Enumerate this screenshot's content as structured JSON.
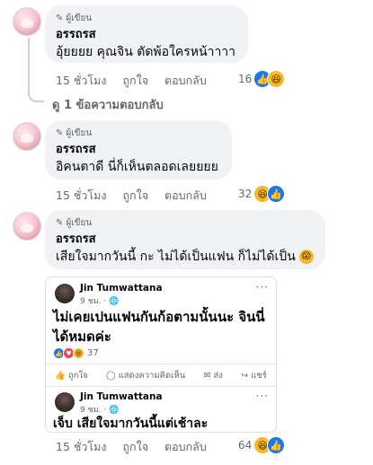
{
  "comments": [
    {
      "badge": "ผู้เขียน",
      "author": "อรรถรส",
      "text": "อุ้ยยยย คุณจิน ตัดพ้อใครหน้าาาา",
      "time": "15 ชั่วโมง",
      "like_label": "ถูกใจ",
      "reply_label": "ตอบกลับ",
      "reaction_count": "16",
      "reactions": [
        "like-icon",
        "haha-icon"
      ]
    },
    {
      "badge": "ผู้เขียน",
      "author": "อรรถรส",
      "text": "อิคนตาดี นี่ก็เห็นตลอดเลยยยย",
      "time": "15 ชั่วโมง",
      "like_label": "ถูกใจ",
      "reply_label": "ตอบกลับ",
      "reaction_count": "32",
      "reactions": [
        "haha-icon",
        "like-icon"
      ]
    },
    {
      "badge": "ผู้เขียน",
      "author": "อรรถรส",
      "text": "เสียใจมากวันนี้ กะ ไม่ได้เป็นแฟน ก็ไม่ได้เป็น",
      "time": "15 ชั่วโมง",
      "like_label": "ถูกใจ",
      "reply_label": "ตอบกลับ",
      "reaction_count": "64",
      "reactions": [
        "haha-icon",
        "like-icon"
      ]
    }
  ],
  "replies_link": "ดู 1 ข้อความตอบกลับ",
  "embedded_post": {
    "name": "Jin Tumwattana",
    "meta": "9 ชม. · ",
    "text_line1": "ไม่เคยเปนแฟนกันก้อตามนั้นนะ จินนี่",
    "text_line2": "ได้หมดค่ะ",
    "reaction_count": "37",
    "like_label": "ถูกใจ",
    "comment_label": "แสดงความคิดเห็น",
    "send_label": "ส่ง",
    "share_label": "แชร์",
    "second_name": "Jin Tumwattana",
    "second_meta": "9 ชม. · ",
    "second_text": "เจ็บ เสียใจมากวันนี้แต่เช้าละ"
  },
  "colors": {
    "like": "#1877f2",
    "haha": "#f7b928",
    "love": "#f33e58",
    "muted": "#65676b",
    "bubble": "#f0f2f5"
  }
}
